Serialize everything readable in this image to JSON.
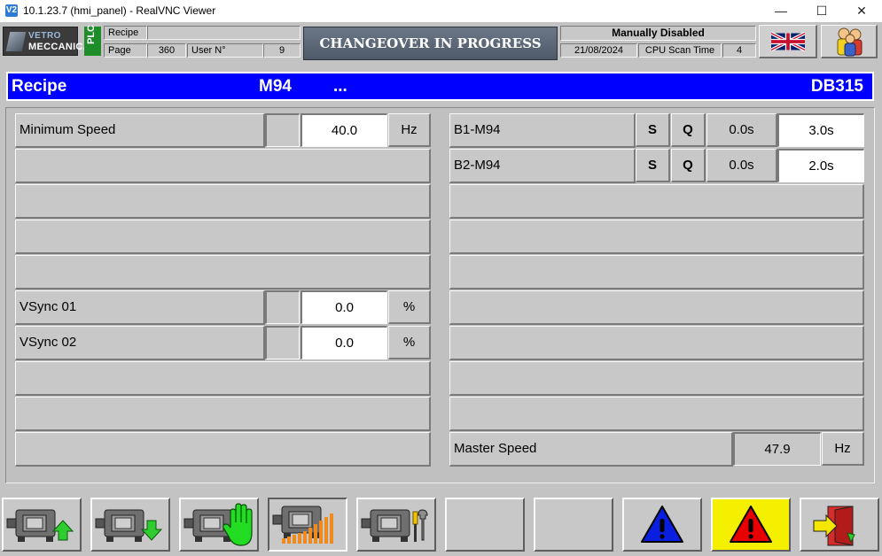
{
  "window": {
    "title": "10.1.23.7 (hmi_panel) - RealVNC Viewer",
    "app_icon": "V2",
    "minimize": "—",
    "maximize": "☐",
    "close": "✕"
  },
  "header": {
    "logo_line1": "VETRO",
    "logo_line2": "MECCANICA",
    "plc_badge": "PLC",
    "recipe_label": "Recipe",
    "recipe_value": "",
    "page_label": "Page",
    "page_value": "360",
    "user_label": "User N°",
    "user_value": "9",
    "status_banner": "CHANGEOVER IN PROGRESS",
    "manual_status": "Manually Disabled",
    "date": "21/08/2024",
    "cpu_label": "CPU Scan Time",
    "cpu_value": "4",
    "language_icon": "uk-flag-icon",
    "users_icon": "users-icon"
  },
  "recipe_bar": {
    "title": "Recipe",
    "code": "M94",
    "name": "...",
    "db": "DB315"
  },
  "left_rows": [
    {
      "label": "Minimum Speed",
      "value": "40.0",
      "unit": "Hz"
    },
    {
      "label": ""
    },
    {
      "label": ""
    },
    {
      "label": ""
    },
    {
      "label": ""
    },
    {
      "label": "VSync 01",
      "value": "0.0",
      "unit": "%"
    },
    {
      "label": "VSync 02",
      "value": "0.0",
      "unit": "%"
    },
    {
      "label": ""
    },
    {
      "label": ""
    },
    {
      "label": ""
    }
  ],
  "right_rows": [
    {
      "label": "B1-M94",
      "s": "S",
      "q": "Q",
      "time": "0.0s",
      "setpoint": "3.0s"
    },
    {
      "label": "B2-M94",
      "s": "S",
      "q": "Q",
      "time": "0.0s",
      "setpoint": "2.0s"
    }
  ],
  "master_speed": {
    "label": "Master Speed",
    "value": "47.9",
    "unit": "Hz"
  },
  "toolbar": [
    {
      "name": "motor-upload-button",
      "icon": "motor-arrow-up-icon"
    },
    {
      "name": "motor-download-button",
      "icon": "motor-arrow-down-icon"
    },
    {
      "name": "motor-manual-button",
      "icon": "motor-hand-icon"
    },
    {
      "name": "motor-ramp-button",
      "icon": "motor-ramp-icon"
    },
    {
      "name": "motor-tools-button",
      "icon": "motor-tools-icon"
    },
    {
      "name": "empty-button-1",
      "icon": ""
    },
    {
      "name": "empty-button-2",
      "icon": ""
    },
    {
      "name": "blue-alarm-button",
      "icon": "blue-warning-icon"
    },
    {
      "name": "red-alarm-button",
      "icon": "red-warning-icon"
    },
    {
      "name": "exit-button",
      "icon": "exit-door-icon"
    }
  ],
  "colors": {
    "recipe_bar": "#0000ff",
    "plc_badge": "#1e8c28",
    "alarm_active_bg": "#f5f000",
    "motor_arrow": "#2ecc2e",
    "hand": "#22dd22"
  }
}
